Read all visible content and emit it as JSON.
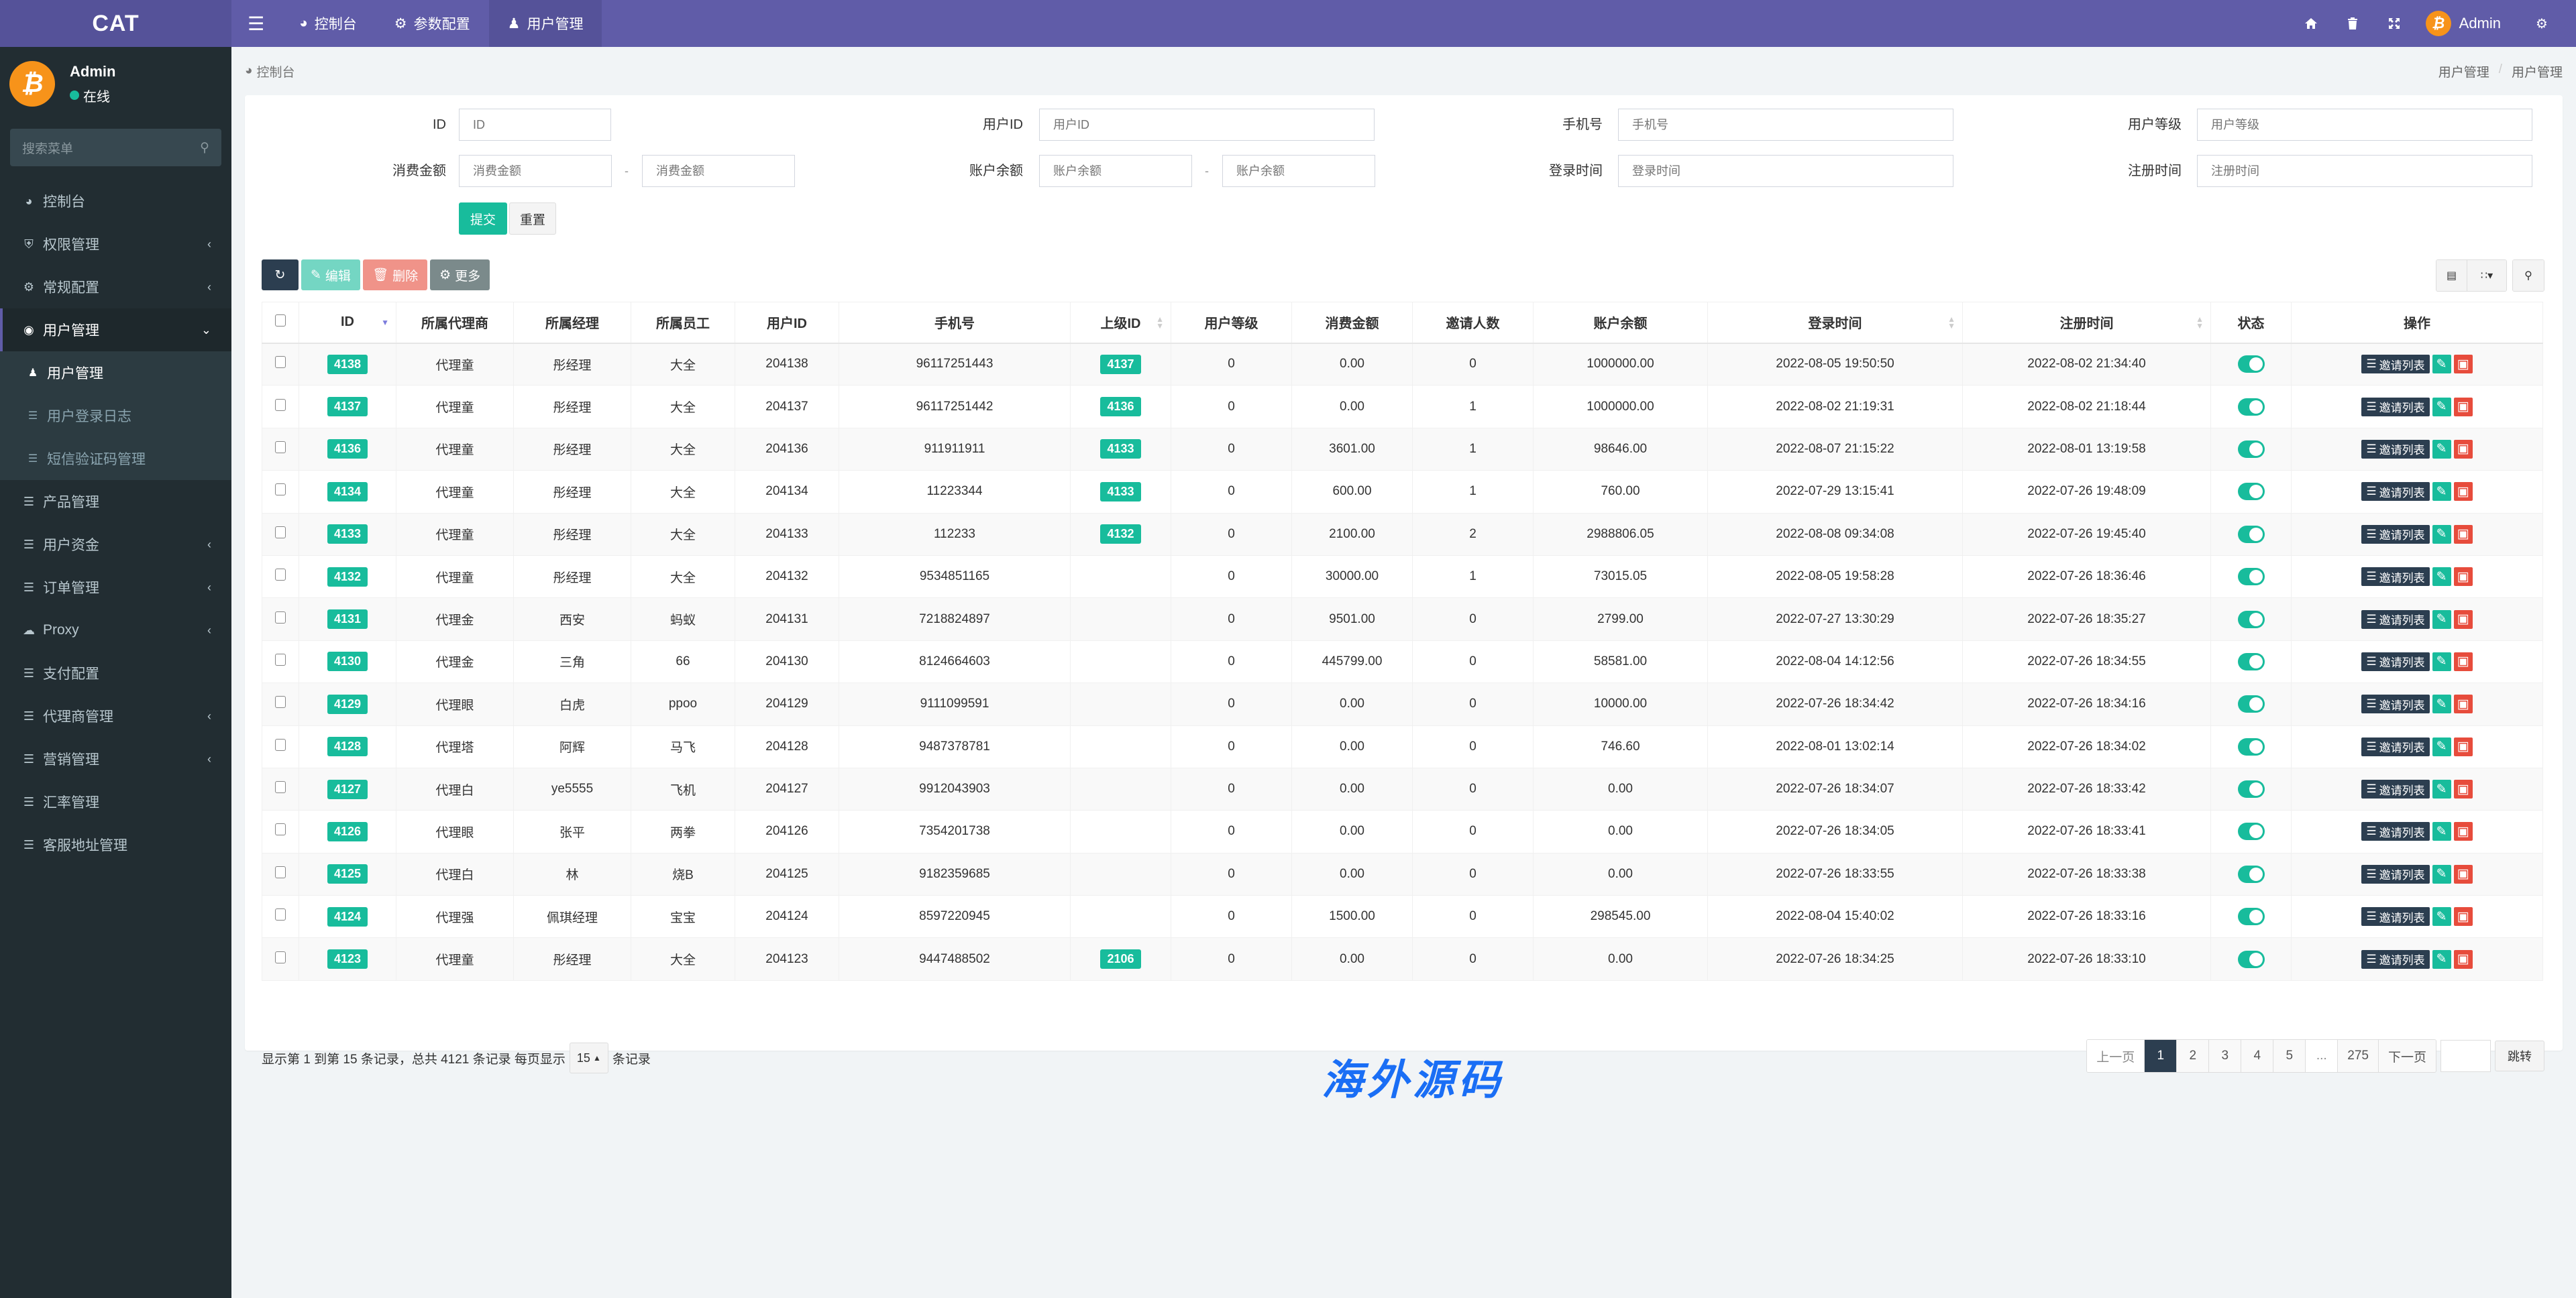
{
  "app": {
    "logo": "CAT",
    "topnav": [
      {
        "icon": "dashboard-icon",
        "label": "控制台"
      },
      {
        "icon": "gear-icon",
        "label": "参数配置"
      },
      {
        "icon": "user-icon",
        "label": "用户管理"
      }
    ],
    "user_name": "Admin"
  },
  "sidebar": {
    "user_name": "Admin",
    "status": "在线",
    "search_placeholder": "搜索菜单",
    "items": [
      {
        "label": "控制台",
        "icon": "dashboard-icon",
        "has_arrow": false
      },
      {
        "label": "权限管理",
        "icon": "shield-icon",
        "has_arrow": true
      },
      {
        "label": "常规配置",
        "icon": "gears-icon",
        "has_arrow": true
      },
      {
        "label": "用户管理",
        "icon": "user-circle-icon",
        "has_arrow": true,
        "open": true
      },
      {
        "label": "产品管理",
        "icon": "list-icon",
        "has_arrow": false
      },
      {
        "label": "用户资金",
        "icon": "list-icon",
        "has_arrow": true
      },
      {
        "label": "订单管理",
        "icon": "list-icon",
        "has_arrow": true
      },
      {
        "label": "Proxy",
        "icon": "cloud-icon",
        "has_arrow": true
      },
      {
        "label": "支付配置",
        "icon": "list-icon",
        "has_arrow": false
      },
      {
        "label": "代理商管理",
        "icon": "list-icon",
        "has_arrow": true
      },
      {
        "label": "营销管理",
        "icon": "list-icon",
        "has_arrow": true
      },
      {
        "label": "汇率管理",
        "icon": "list-icon",
        "has_arrow": false
      },
      {
        "label": "客服地址管理",
        "icon": "list-icon",
        "has_arrow": false
      }
    ],
    "submenu": [
      {
        "label": "用户管理",
        "icon": "user-icon",
        "active": true
      },
      {
        "label": "用户登录日志",
        "icon": "list-icon",
        "active": false
      },
      {
        "label": "短信验证码管理",
        "icon": "list-icon",
        "active": false
      }
    ]
  },
  "breadcrumb": {
    "left": "控制台",
    "right": [
      "用户管理",
      "用户管理"
    ]
  },
  "filters": {
    "id": {
      "label": "ID",
      "placeholder": "ID"
    },
    "user_id": {
      "label": "用户ID",
      "placeholder": "用户ID"
    },
    "phone": {
      "label": "手机号",
      "placeholder": "手机号"
    },
    "level": {
      "label": "用户等级",
      "placeholder": "用户等级"
    },
    "spend": {
      "label": "消费金额",
      "placeholder_min": "消费金额",
      "placeholder_max": "消费金额"
    },
    "balance": {
      "label": "账户余额",
      "placeholder_min": "账户余额",
      "placeholder_max": "账户余额"
    },
    "login_time": {
      "label": "登录时间",
      "placeholder": "登录时间"
    },
    "reg_time": {
      "label": "注册时间",
      "placeholder": "注册时间"
    },
    "dash": "-",
    "submit": "提交",
    "reset": "重置"
  },
  "toolbar": {
    "edit": "编辑",
    "delete": "删除",
    "more": "更多"
  },
  "table": {
    "columns": [
      "ID",
      "所属代理商",
      "所属经理",
      "所属员工",
      "用户ID",
      "手机号",
      "上级ID",
      "用户等级",
      "消费金额",
      "邀请人数",
      "账户余额",
      "登录时间",
      "注册时间",
      "状态",
      "操作"
    ],
    "invite_label": "邀请列表",
    "rows": [
      {
        "id": "4138",
        "agent": "代理童",
        "manager": "彤经理",
        "staff": "大全",
        "user_id": "204138",
        "phone": "96117251443",
        "parent_id": "4137",
        "level": "0",
        "spend": "0.00",
        "invites": "0",
        "balance": "1000000.00",
        "login_time": "2022-08-05 19:50:50",
        "reg_time": "2022-08-02 21:34:40",
        "status": true
      },
      {
        "id": "4137",
        "agent": "代理童",
        "manager": "彤经理",
        "staff": "大全",
        "user_id": "204137",
        "phone": "96117251442",
        "parent_id": "4136",
        "level": "0",
        "spend": "0.00",
        "invites": "1",
        "balance": "1000000.00",
        "login_time": "2022-08-02 21:19:31",
        "reg_time": "2022-08-02 21:18:44",
        "status": true
      },
      {
        "id": "4136",
        "agent": "代理童",
        "manager": "彤经理",
        "staff": "大全",
        "user_id": "204136",
        "phone": "911911911",
        "parent_id": "4133",
        "level": "0",
        "spend": "3601.00",
        "invites": "1",
        "balance": "98646.00",
        "login_time": "2022-08-07 21:15:22",
        "reg_time": "2022-08-01 13:19:58",
        "status": true
      },
      {
        "id": "4134",
        "agent": "代理童",
        "manager": "彤经理",
        "staff": "大全",
        "user_id": "204134",
        "phone": "11223344",
        "parent_id": "4133",
        "level": "0",
        "spend": "600.00",
        "invites": "1",
        "balance": "760.00",
        "login_time": "2022-07-29 13:15:41",
        "reg_time": "2022-07-26 19:48:09",
        "status": true
      },
      {
        "id": "4133",
        "agent": "代理童",
        "manager": "彤经理",
        "staff": "大全",
        "user_id": "204133",
        "phone": "112233",
        "parent_id": "4132",
        "level": "0",
        "spend": "2100.00",
        "invites": "2",
        "balance": "2988806.05",
        "login_time": "2022-08-08 09:34:08",
        "reg_time": "2022-07-26 19:45:40",
        "status": true
      },
      {
        "id": "4132",
        "agent": "代理童",
        "manager": "彤经理",
        "staff": "大全",
        "user_id": "204132",
        "phone": "9534851165",
        "parent_id": "",
        "level": "0",
        "spend": "30000.00",
        "invites": "1",
        "balance": "73015.05",
        "login_time": "2022-08-05 19:58:28",
        "reg_time": "2022-07-26 18:36:46",
        "status": true
      },
      {
        "id": "4131",
        "agent": "代理金",
        "manager": "西安",
        "staff": "蚂蚁",
        "user_id": "204131",
        "phone": "7218824897",
        "parent_id": "",
        "level": "0",
        "spend": "9501.00",
        "invites": "0",
        "balance": "2799.00",
        "login_time": "2022-07-27 13:30:29",
        "reg_time": "2022-07-26 18:35:27",
        "status": true
      },
      {
        "id": "4130",
        "agent": "代理金",
        "manager": "三角",
        "staff": "66",
        "user_id": "204130",
        "phone": "8124664603",
        "parent_id": "",
        "level": "0",
        "spend": "445799.00",
        "invites": "0",
        "balance": "58581.00",
        "login_time": "2022-08-04 14:12:56",
        "reg_time": "2022-07-26 18:34:55",
        "status": true
      },
      {
        "id": "4129",
        "agent": "代理眼",
        "manager": "白虎",
        "staff": "ppoo",
        "user_id": "204129",
        "phone": "9111099591",
        "parent_id": "",
        "level": "0",
        "spend": "0.00",
        "invites": "0",
        "balance": "10000.00",
        "login_time": "2022-07-26 18:34:42",
        "reg_time": "2022-07-26 18:34:16",
        "status": true
      },
      {
        "id": "4128",
        "agent": "代理塔",
        "manager": "阿辉",
        "staff": "马飞",
        "user_id": "204128",
        "phone": "9487378781",
        "parent_id": "",
        "level": "0",
        "spend": "0.00",
        "invites": "0",
        "balance": "746.60",
        "login_time": "2022-08-01 13:02:14",
        "reg_time": "2022-07-26 18:34:02",
        "status": true
      },
      {
        "id": "4127",
        "agent": "代理白",
        "manager": "ye5555",
        "staff": "飞机",
        "user_id": "204127",
        "phone": "9912043903",
        "parent_id": "",
        "level": "0",
        "spend": "0.00",
        "invites": "0",
        "balance": "0.00",
        "login_time": "2022-07-26 18:34:07",
        "reg_time": "2022-07-26 18:33:42",
        "status": true
      },
      {
        "id": "4126",
        "agent": "代理眼",
        "manager": "张平",
        "staff": "两拳",
        "user_id": "204126",
        "phone": "7354201738",
        "parent_id": "",
        "level": "0",
        "spend": "0.00",
        "invites": "0",
        "balance": "0.00",
        "login_time": "2022-07-26 18:34:05",
        "reg_time": "2022-07-26 18:33:41",
        "status": true
      },
      {
        "id": "4125",
        "agent": "代理白",
        "manager": "林",
        "staff": "烧B",
        "user_id": "204125",
        "phone": "9182359685",
        "parent_id": "",
        "level": "0",
        "spend": "0.00",
        "invites": "0",
        "balance": "0.00",
        "login_time": "2022-07-26 18:33:55",
        "reg_time": "2022-07-26 18:33:38",
        "status": true
      },
      {
        "id": "4124",
        "agent": "代理强",
        "manager": "佩琪经理",
        "staff": "宝宝",
        "user_id": "204124",
        "phone": "8597220945",
        "parent_id": "",
        "level": "0",
        "spend": "1500.00",
        "invites": "0",
        "balance": "298545.00",
        "login_time": "2022-08-04 15:40:02",
        "reg_time": "2022-07-26 18:33:16",
        "status": true
      },
      {
        "id": "4123",
        "agent": "代理童",
        "manager": "彤经理",
        "staff": "大全",
        "user_id": "204123",
        "phone": "9447488502",
        "parent_id": "2106",
        "level": "0",
        "spend": "0.00",
        "invites": "0",
        "balance": "0.00",
        "login_time": "2022-07-26 18:34:25",
        "reg_time": "2022-07-26 18:33:10",
        "status": true
      }
    ]
  },
  "pagination": {
    "info_prefix": "显示第 1 到第 15 条记录，总共 4121 条记录 每页显示",
    "page_size": "15",
    "info_suffix": "条记录",
    "prev": "上一页",
    "pages": [
      "1",
      "2",
      "3",
      "4",
      "5",
      "...",
      "275"
    ],
    "current": "1",
    "next": "下一页",
    "jump": "跳转"
  },
  "watermark": "海外源码",
  "colors": {
    "header": "#605ca8",
    "sidebar": "#222d32",
    "success": "#18bc9c",
    "danger": "#e74c3c",
    "primary_dark": "#2c3e50"
  }
}
